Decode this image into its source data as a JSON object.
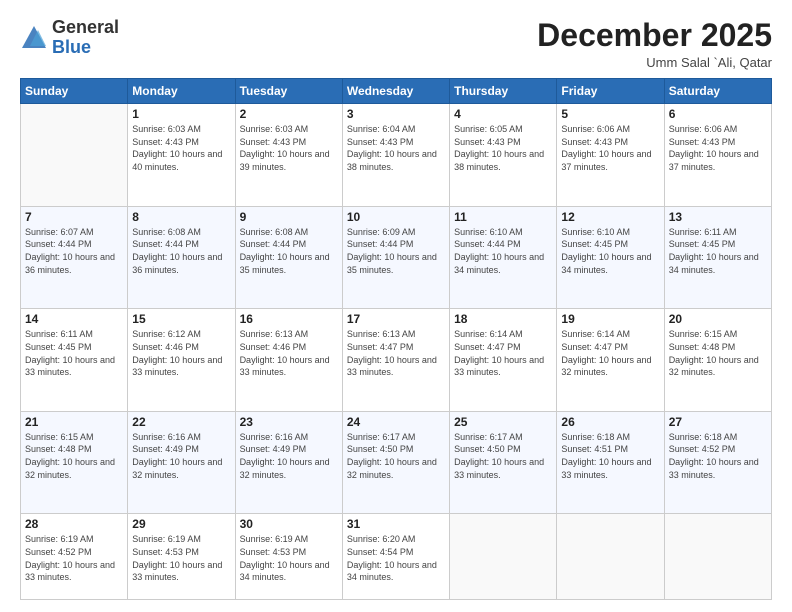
{
  "header": {
    "logo_general": "General",
    "logo_blue": "Blue",
    "month_title": "December 2025",
    "location": "Umm Salal `Ali, Qatar"
  },
  "weekdays": [
    "Sunday",
    "Monday",
    "Tuesday",
    "Wednesday",
    "Thursday",
    "Friday",
    "Saturday"
  ],
  "weeks": [
    [
      {
        "day": "",
        "empty": true
      },
      {
        "day": "1",
        "sunrise": "6:03 AM",
        "sunset": "4:43 PM",
        "daylight": "10 hours and 40 minutes."
      },
      {
        "day": "2",
        "sunrise": "6:03 AM",
        "sunset": "4:43 PM",
        "daylight": "10 hours and 39 minutes."
      },
      {
        "day": "3",
        "sunrise": "6:04 AM",
        "sunset": "4:43 PM",
        "daylight": "10 hours and 38 minutes."
      },
      {
        "day": "4",
        "sunrise": "6:05 AM",
        "sunset": "4:43 PM",
        "daylight": "10 hours and 38 minutes."
      },
      {
        "day": "5",
        "sunrise": "6:06 AM",
        "sunset": "4:43 PM",
        "daylight": "10 hours and 37 minutes."
      },
      {
        "day": "6",
        "sunrise": "6:06 AM",
        "sunset": "4:43 PM",
        "daylight": "10 hours and 37 minutes."
      }
    ],
    [
      {
        "day": "7",
        "sunrise": "6:07 AM",
        "sunset": "4:44 PM",
        "daylight": "10 hours and 36 minutes."
      },
      {
        "day": "8",
        "sunrise": "6:08 AM",
        "sunset": "4:44 PM",
        "daylight": "10 hours and 36 minutes."
      },
      {
        "day": "9",
        "sunrise": "6:08 AM",
        "sunset": "4:44 PM",
        "daylight": "10 hours and 35 minutes."
      },
      {
        "day": "10",
        "sunrise": "6:09 AM",
        "sunset": "4:44 PM",
        "daylight": "10 hours and 35 minutes."
      },
      {
        "day": "11",
        "sunrise": "6:10 AM",
        "sunset": "4:44 PM",
        "daylight": "10 hours and 34 minutes."
      },
      {
        "day": "12",
        "sunrise": "6:10 AM",
        "sunset": "4:45 PM",
        "daylight": "10 hours and 34 minutes."
      },
      {
        "day": "13",
        "sunrise": "6:11 AM",
        "sunset": "4:45 PM",
        "daylight": "10 hours and 34 minutes."
      }
    ],
    [
      {
        "day": "14",
        "sunrise": "6:11 AM",
        "sunset": "4:45 PM",
        "daylight": "10 hours and 33 minutes."
      },
      {
        "day": "15",
        "sunrise": "6:12 AM",
        "sunset": "4:46 PM",
        "daylight": "10 hours and 33 minutes."
      },
      {
        "day": "16",
        "sunrise": "6:13 AM",
        "sunset": "4:46 PM",
        "daylight": "10 hours and 33 minutes."
      },
      {
        "day": "17",
        "sunrise": "6:13 AM",
        "sunset": "4:47 PM",
        "daylight": "10 hours and 33 minutes."
      },
      {
        "day": "18",
        "sunrise": "6:14 AM",
        "sunset": "4:47 PM",
        "daylight": "10 hours and 33 minutes."
      },
      {
        "day": "19",
        "sunrise": "6:14 AM",
        "sunset": "4:47 PM",
        "daylight": "10 hours and 32 minutes."
      },
      {
        "day": "20",
        "sunrise": "6:15 AM",
        "sunset": "4:48 PM",
        "daylight": "10 hours and 32 minutes."
      }
    ],
    [
      {
        "day": "21",
        "sunrise": "6:15 AM",
        "sunset": "4:48 PM",
        "daylight": "10 hours and 32 minutes."
      },
      {
        "day": "22",
        "sunrise": "6:16 AM",
        "sunset": "4:49 PM",
        "daylight": "10 hours and 32 minutes."
      },
      {
        "day": "23",
        "sunrise": "6:16 AM",
        "sunset": "4:49 PM",
        "daylight": "10 hours and 32 minutes."
      },
      {
        "day": "24",
        "sunrise": "6:17 AM",
        "sunset": "4:50 PM",
        "daylight": "10 hours and 32 minutes."
      },
      {
        "day": "25",
        "sunrise": "6:17 AM",
        "sunset": "4:50 PM",
        "daylight": "10 hours and 33 minutes."
      },
      {
        "day": "26",
        "sunrise": "6:18 AM",
        "sunset": "4:51 PM",
        "daylight": "10 hours and 33 minutes."
      },
      {
        "day": "27",
        "sunrise": "6:18 AM",
        "sunset": "4:52 PM",
        "daylight": "10 hours and 33 minutes."
      }
    ],
    [
      {
        "day": "28",
        "sunrise": "6:19 AM",
        "sunset": "4:52 PM",
        "daylight": "10 hours and 33 minutes."
      },
      {
        "day": "29",
        "sunrise": "6:19 AM",
        "sunset": "4:53 PM",
        "daylight": "10 hours and 33 minutes."
      },
      {
        "day": "30",
        "sunrise": "6:19 AM",
        "sunset": "4:53 PM",
        "daylight": "10 hours and 34 minutes."
      },
      {
        "day": "31",
        "sunrise": "6:20 AM",
        "sunset": "4:54 PM",
        "daylight": "10 hours and 34 minutes."
      },
      {
        "day": "",
        "empty": true
      },
      {
        "day": "",
        "empty": true
      },
      {
        "day": "",
        "empty": true
      }
    ]
  ],
  "labels": {
    "sunrise_prefix": "Sunrise: ",
    "sunset_prefix": "Sunset: ",
    "daylight_prefix": "Daylight: "
  }
}
